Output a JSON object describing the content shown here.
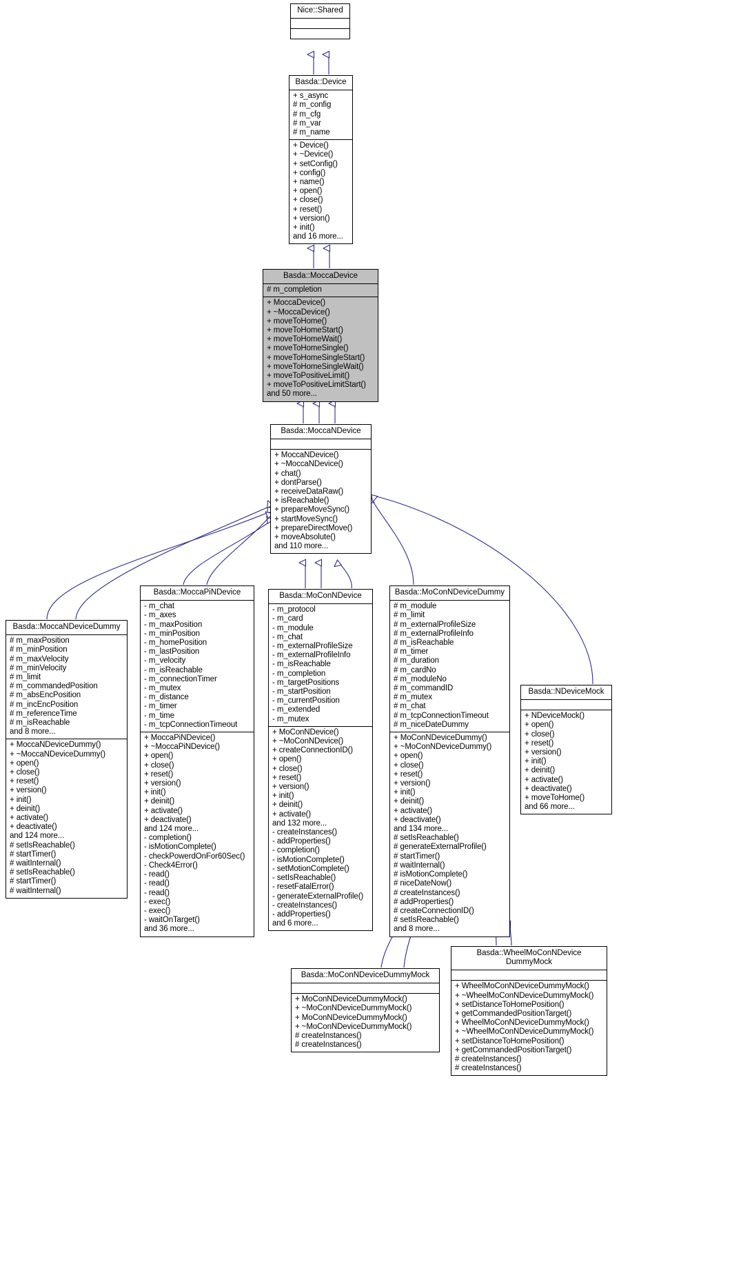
{
  "diagram": {
    "kind": "uml-class-inheritance-diagram",
    "highlight_color": "#c0c0c0",
    "edge_color": "#2a2a8c",
    "box_border_color": "#000000"
  },
  "classes": {
    "nice_shared": {
      "name": "Nice::Shared",
      "attributes": [],
      "methods": []
    },
    "basda_device": {
      "name": "Basda::Device",
      "attributes": [
        "+ s_async",
        "# m_config",
        "# m_cfg",
        "# m_var",
        "# m_name"
      ],
      "methods": [
        "+ Device()",
        "+ ~Device()",
        "+ setConfig()",
        "+ config()",
        "+ name()",
        "+ open()",
        "+ close()",
        "+ reset()",
        "+ version()",
        "+ init()",
        "and 16 more..."
      ]
    },
    "mocca_device": {
      "name": "Basda::MoccaDevice",
      "attributes": [
        "# m_completion"
      ],
      "methods": [
        "+ MoccaDevice()",
        "+ ~MoccaDevice()",
        "+ moveToHome()",
        "+ moveToHomeStart()",
        "+ moveToHomeWait()",
        "+ moveToHomeSingle()",
        "+ moveToHomeSingleStart()",
        "+ moveToHomeSingleWait()",
        "+ moveToPositiveLimit()",
        "+ moveToPositiveLimitStart()",
        "and 50 more..."
      ]
    },
    "mocca_ndevice": {
      "name": "Basda::MoccaNDevice",
      "attributes": [],
      "methods": [
        "+ MoccaNDevice()",
        "+ ~MoccaNDevice()",
        "+ chat()",
        "+ dontParse()",
        "+ receiveDataRaw()",
        "+ isReachable()",
        "+ prepareMoveSync()",
        "+ startMoveSync()",
        "+ prepareDirectMove()",
        "+ moveAbsolute()",
        "and 110 more..."
      ]
    },
    "mocca_ndevice_dummy": {
      "name": "Basda::MoccaNDeviceDummy",
      "attributes": [
        "# m_maxPosition",
        "# m_minPosition",
        "# m_maxVelocity",
        "# m_minVelocity",
        "# m_limit",
        "# m_commandedPosition",
        "# m_absEncPosition",
        "# m_incEncPosition",
        "# m_referenceTime",
        "# m_isReachable",
        "and 8 more..."
      ],
      "methods": [
        "+ MoccaNDeviceDummy()",
        "+ ~MoccaNDeviceDummy()",
        "+ open()",
        "+ close()",
        "+ reset()",
        "+ version()",
        "+ init()",
        "+ deinit()",
        "+ activate()",
        "+ deactivate()",
        "and 124 more...",
        "# setIsReachable()",
        "# startTimer()",
        "# waitInternal()",
        "# setIsReachable()",
        "# startTimer()",
        "# waitInternal()"
      ]
    },
    "mocca_pindevice": {
      "name": "Basda::MoccaPiNDevice",
      "attributes": [
        "- m_chat",
        "- m_axes",
        "- m_maxPosition",
        "- m_minPosition",
        "- m_homePosition",
        "- m_lastPosition",
        "- m_velocity",
        "- m_isReachable",
        "- m_connectionTimer",
        "- m_mutex",
        "- m_distance",
        "- m_timer",
        "- m_time",
        "- m_tcpConnectionTimeout"
      ],
      "methods": [
        "+ MoccaPiNDevice()",
        "+ ~MoccaPiNDevice()",
        "+ open()",
        "+ close()",
        "+ reset()",
        "+ version()",
        "+ init()",
        "+ deinit()",
        "+ activate()",
        "+ deactivate()",
        "and 124 more...",
        "- completion()",
        "- isMotionComplete()",
        "- checkPowerdOnFor60Sec()",
        "- Check4Error()",
        "- read()",
        "- read()",
        "- read()",
        "- exec()",
        "- exec()",
        "- waitOnTarget()",
        "and 36 more..."
      ]
    },
    "mocon_ndevice": {
      "name": "Basda::MoConNDevice",
      "attributes": [
        "- m_protocol",
        "- m_card",
        "- m_module",
        "- m_chat",
        "- m_externalProfileSize",
        "- m_externalProfileInfo",
        "- m_isReachable",
        "- m_completion",
        "- m_targetPositions",
        "- m_startPosition",
        "- m_currentPosition",
        "- m_extended",
        "- m_mutex"
      ],
      "methods": [
        "+ MoConNDevice()",
        "+ ~MoConNDevice()",
        "+ createConnectionID()",
        "+ open()",
        "+ close()",
        "+ reset()",
        "+ version()",
        "+ init()",
        "+ deinit()",
        "+ activate()",
        "and 132 more...",
        "- createInstances()",
        "- addProperties()",
        "- completion()",
        "- isMotionComplete()",
        "- setMotionComplete()",
        "- setIsReachable()",
        "- resetFatalError()",
        "- generateExternalProfile()",
        "- createInstances()",
        "- addProperties()",
        "and 6 more..."
      ]
    },
    "mocon_ndevice_dummy": {
      "name": "Basda::MoConNDeviceDummy",
      "attributes": [
        "# m_module",
        "# m_limit",
        "# m_externalProfileSize",
        "# m_externalProfileInfo",
        "# m_isReachable",
        "# m_timer",
        "# m_duration",
        "# m_cardNo",
        "# m_moduleNo",
        "# m_commandID",
        "# m_mutex",
        "# m_chat",
        "# m_tcpConnectionTimeout",
        "# m_niceDateDummy"
      ],
      "methods": [
        "+ MoConNDeviceDummy()",
        "+ ~MoConNDeviceDummy()",
        "+ open()",
        "+ close()",
        "+ reset()",
        "+ version()",
        "+ init()",
        "+ deinit()",
        "+ activate()",
        "+ deactivate()",
        "and 134 more...",
        "# setIsReachable()",
        "# generateExternalProfile()",
        "# startTimer()",
        "# waitInternal()",
        "# isMotionComplete()",
        "# niceDateNow()",
        "# createInstances()",
        "# addProperties()",
        "# createConnectionID()",
        "# setIsReachable()",
        "and 8 more..."
      ]
    },
    "ndevice_mock": {
      "name": "Basda::NDeviceMock",
      "attributes": [],
      "methods": [
        "+ NDeviceMock()",
        "+ open()",
        "+ close()",
        "+ reset()",
        "+ version()",
        "+ init()",
        "+ deinit()",
        "+ activate()",
        "+ deactivate()",
        "+ moveToHome()",
        "and 66 more..."
      ]
    },
    "mocon_ndevice_dummy_mock": {
      "name": "Basda::MoConNDeviceDummyMock",
      "attributes": [],
      "methods": [
        "+ MoConNDeviceDummyMock()",
        "+ ~MoConNDeviceDummyMock()",
        "+ MoConNDeviceDummyMock()",
        "+ ~MoConNDeviceDummyMock()",
        "# createInstances()",
        "# createInstances()"
      ]
    },
    "wheel_mocon_ndevice_dummy_mock": {
      "name": "Basda::WheelMoConNDevice\nDummyMock",
      "attributes": [],
      "methods": [
        "+ WheelMoConNDeviceDummyMock()",
        "+ ~WheelMoConNDeviceDummyMock()",
        "+ setDistanceToHomePosition()",
        "+ getCommandedPositionTarget()",
        "+ WheelMoConNDeviceDummyMock()",
        "+ ~WheelMoConNDeviceDummyMock()",
        "+ setDistanceToHomePosition()",
        "+ getCommandedPositionTarget()",
        "# createInstances()",
        "# createInstances()"
      ]
    }
  }
}
